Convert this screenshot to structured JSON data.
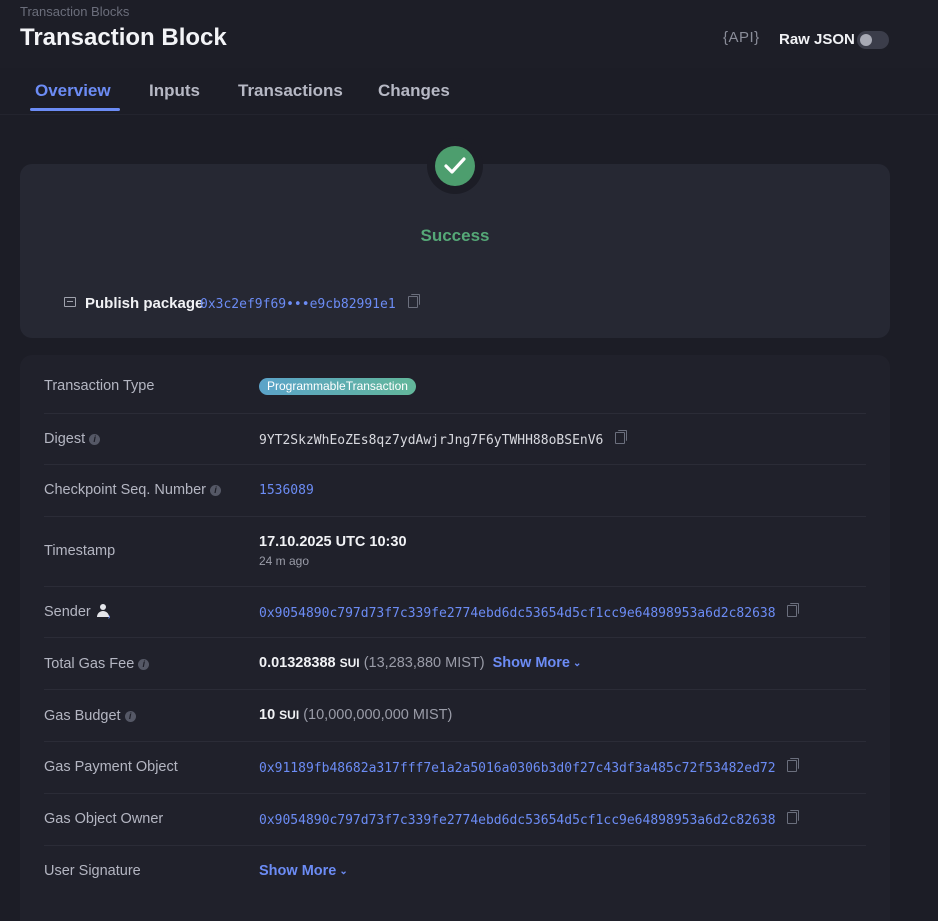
{
  "header": {
    "breadcrumb": "Transaction Blocks",
    "title": "Transaction Block",
    "api_label": "{API}",
    "raw_json_label": "Raw JSON",
    "raw_json_enabled": false
  },
  "tabs": [
    {
      "label": "Overview",
      "active": true
    },
    {
      "label": "Inputs",
      "active": false
    },
    {
      "label": "Transactions",
      "active": false
    },
    {
      "label": "Changes",
      "active": false
    }
  ],
  "status": {
    "text": "Success",
    "color": "#55a877",
    "publish_label": "Publish package",
    "package_id": "0x3c2ef9f69•••e9cb82991e1"
  },
  "details": {
    "transaction_type": {
      "label": "Transaction Type",
      "value": "ProgrammableTransaction"
    },
    "digest": {
      "label": "Digest",
      "value": "9YT2SkzWhEoZEs8qz7ydAwjrJng7F6yTWHH88oBSEnV6"
    },
    "checkpoint": {
      "label": "Checkpoint Seq. Number",
      "value": "1536089"
    },
    "timestamp": {
      "label": "Timestamp",
      "value": "17.10.2025 UTC 10:30",
      "relative": "24 m ago"
    },
    "sender": {
      "label": "Sender",
      "value": "0x9054890c797d73f7c339fe2774ebd6dc53654d5cf1cc9e64898953a6d2c82638"
    },
    "total_gas_fee": {
      "label": "Total Gas Fee",
      "amount": "0.01328388",
      "unit": "SUI",
      "mist": "(13,283,880 MIST)",
      "show_more": "Show More"
    },
    "gas_budget": {
      "label": "Gas Budget",
      "amount": "10",
      "unit": "SUI",
      "mist": "(10,000,000,000 MIST)"
    },
    "gas_payment_object": {
      "label": "Gas Payment Object",
      "value": "0x91189fb48682a317fff7e1a2a5016a0306b3d0f27c43df3a485c72f53482ed72"
    },
    "gas_object_owner": {
      "label": "Gas Object Owner",
      "value": "0x9054890c797d73f7c339fe2774ebd6dc53654d5cf1cc9e64898953a6d2c82638"
    },
    "user_signature": {
      "label": "User Signature",
      "show_more": "Show More"
    }
  },
  "colors": {
    "accent": "#6c8cf5",
    "success": "#4d9e6e",
    "background": "#1c1d26"
  }
}
